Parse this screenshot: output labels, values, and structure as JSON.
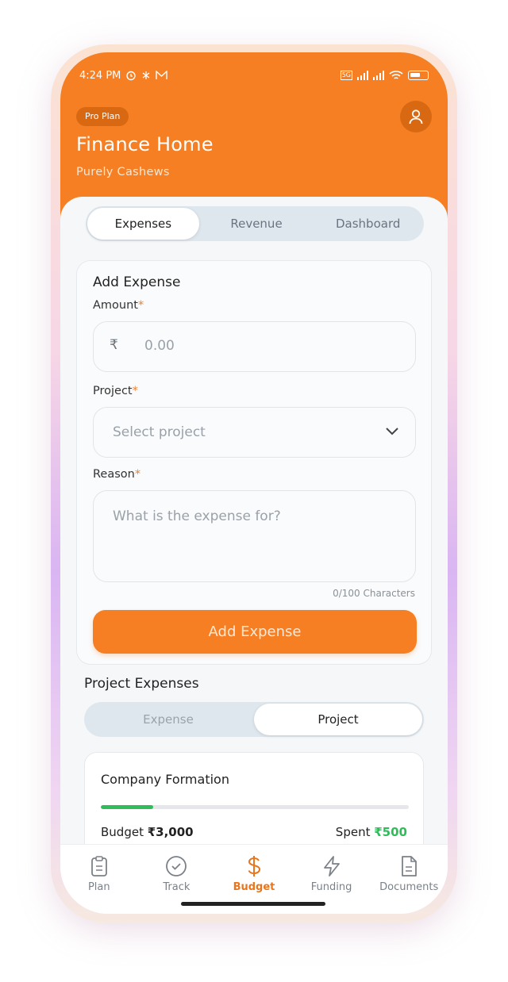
{
  "status": {
    "time": "4:24 PM",
    "network": "5G"
  },
  "header": {
    "plan_badge": "Pro Plan",
    "title": "Finance Home",
    "subtitle": "Purely Cashews"
  },
  "tabs": [
    {
      "label": "Expenses",
      "active": true
    },
    {
      "label": "Revenue",
      "active": false
    },
    {
      "label": "Dashboard",
      "active": false
    }
  ],
  "form": {
    "title": "Add Expense",
    "amount_label": "Amount",
    "required_mark": "*",
    "currency_symbol": "₹",
    "amount_placeholder": "0.00",
    "project_label": "Project",
    "project_placeholder": "Select project",
    "reason_label": "Reason",
    "reason_placeholder": "What is the expense for?",
    "char_counter": "0/100 Characters",
    "submit_label": "Add Expense"
  },
  "project_expenses": {
    "title": "Project Expenses",
    "segments": [
      {
        "label": "Expense",
        "active": false
      },
      {
        "label": "Project",
        "active": true
      }
    ],
    "cards": [
      {
        "name": "Company Formation",
        "progress": 0.17,
        "budget_label": "Budget",
        "budget_value": "₹3,000",
        "spent_label": "Spent",
        "spent_value": "₹500"
      }
    ]
  },
  "nav": [
    {
      "label": "Plan",
      "icon": "clipboard-icon",
      "active": false
    },
    {
      "label": "Track",
      "icon": "check-circle-icon",
      "active": false
    },
    {
      "label": "Budget",
      "icon": "dollar-icon",
      "active": true
    },
    {
      "label": "Funding",
      "icon": "lightning-icon",
      "active": false
    },
    {
      "label": "Documents",
      "icon": "document-icon",
      "active": false
    }
  ],
  "colors": {
    "accent": "#f57f22",
    "success": "#2ebd59"
  }
}
